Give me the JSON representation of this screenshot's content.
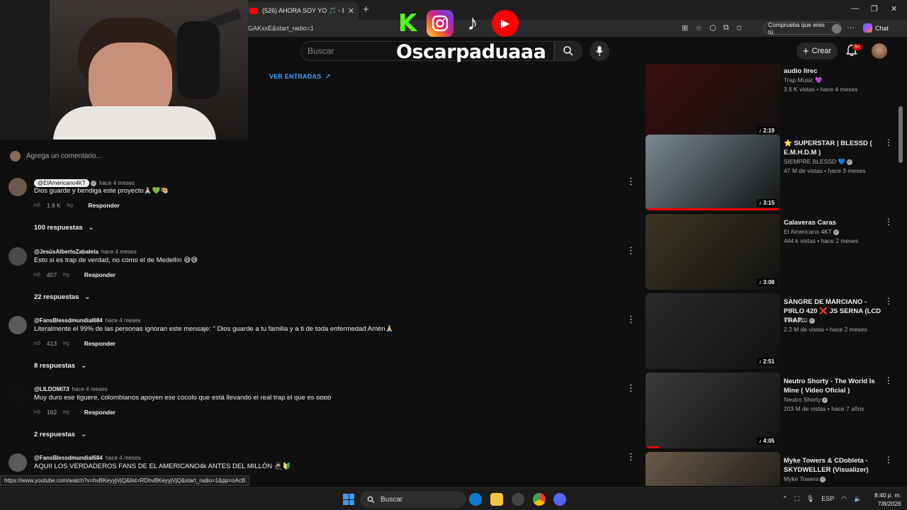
{
  "browser": {
    "tab_title": "(526) AHORA SOY YO 🎵 - El Ame",
    "url_fragment": "GAKxxE&start_radio=1",
    "profile_button": "Comprueba que eres tú",
    "chat_label": "Chat"
  },
  "overlay": {
    "streamer_name": "Oscarpaduaaa",
    "socials": [
      "kick-icon",
      "instagram-icon",
      "tiktok-icon",
      "youtube-icon"
    ]
  },
  "youtube_header": {
    "search_placeholder": "Buscar",
    "create_label": "Crear",
    "notif_count": "9+"
  },
  "ver_entradas": "VER ENTRADAS",
  "add_comment_placeholder": "Agrega un comentario...",
  "comments": [
    {
      "author": "@ElAmericano4KT",
      "time": "hace 4 meses",
      "text": "Dios guarde y bendiga este proyecto🙏🏼💚🤏🏼",
      "likes": "1.9 K",
      "reply": "Responder",
      "replies": "100 respuestas",
      "is_creator": true
    },
    {
      "author": "@JesúsAlbertoZabaleta",
      "time": "hace 4 meses",
      "text": "Esto si es trap de verdad, no como el de Medellín 😅😅",
      "likes": "457",
      "reply": "Responder",
      "replies": "22 respuestas",
      "is_creator": false
    },
    {
      "author": "@FansBlessdmundial684",
      "time": "hace 4 meses",
      "text": "Literalmente el 99% de las personas ignoran este mensaje: \" Dios guarde a tu familia y a ti de toda enfermedad Amén🙏🏼",
      "likes": "413",
      "reply": "Responder",
      "replies": "8 respuestas",
      "is_creator": false
    },
    {
      "author": "@LILDOMI73",
      "time": "hace 4 meses",
      "text": "Muy duro ese tiguere, colombianos apoyen ese cocolo que está llevando el real trap el que es ɒɒɒɒ",
      "likes": "162",
      "reply": "Responder",
      "replies": "2 respuestas",
      "is_creator": false
    },
    {
      "author": "@FansBlessdmundial684",
      "time": "hace 4 meses",
      "text": "AQUII LOS VERDADEROS FANS DE EL AMERICANO4k ANTES DEL MILLÓN 🥷🏼🔰",
      "likes": "",
      "reply": "",
      "replies": "",
      "is_creator": false
    }
  ],
  "related_videos": [
    {
      "title": "audio lirec",
      "channel": "Trap Music 💜",
      "meta": "3.6 K vistas • hace 4 meses",
      "duration": "2:19",
      "thumb_color": "#3a0d0d",
      "verified": false
    },
    {
      "title": "⭐ SUPERSTAR | BLESSD ( E.M.H.D.M )",
      "channel": "SIEMPRE BLESSD 💙",
      "meta": "47 M de vistas • hace 3 meses",
      "duration": "3:15",
      "thumb_color": "#7a8a92",
      "verified": true
    },
    {
      "title": "Calaveras Caras",
      "channel": "El Americano 4KT",
      "meta": "444 k vistas • hace 2 meses",
      "duration": "3:08",
      "thumb_color": "#3b3522",
      "verified": true
    },
    {
      "title": "SANGRE DE MARCIANO - PIRLO 420 ❌ JS SERNA (LCD TRAP...",
      "channel": "Pirlo 420",
      "meta": "2.2 M de vistas • hace 2 meses",
      "duration": "2:51",
      "thumb_color": "#2a2a2a",
      "verified": true
    },
    {
      "title": "Neutro Shorty - The World Is Mine ( Video Oficial )",
      "channel": "Neutro Shorty",
      "meta": "203 M de vistas • hace 7 años",
      "duration": "4:05",
      "thumb_color": "#3a3a3a",
      "verified": true
    },
    {
      "title": "Myke Towers & CDobleta - SKYDWELLER (Visualizer)",
      "channel": "Myke Towers",
      "meta": "4 M de vistas • hace 1 año",
      "duration": "",
      "thumb_color": "#6a5a4a",
      "verified": true
    }
  ],
  "status_url": "https://www.youtube.com/watch?v=hvBKeyyjVjQ&list=RDhvBKeyyjVjQ&start_radio=1&pp=oAcB",
  "taskbar": {
    "search_label": "Buscar",
    "language": "ESP",
    "time": "8:40 p. m.",
    "date": "7/8/2026"
  }
}
